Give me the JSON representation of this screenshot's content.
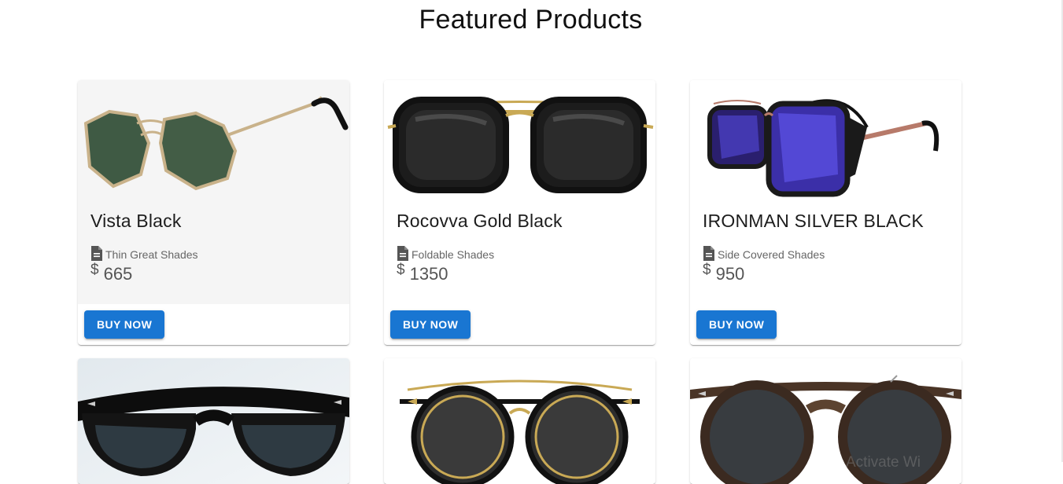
{
  "page": {
    "title": "Featured Products"
  },
  "products": [
    {
      "name": "Vista Black",
      "description": "Thin Great Shades",
      "currency_symbol": "$",
      "price": "665",
      "button_label": "BUY NOW",
      "image_icon": "aviator-hexagon-green-lens-sunglasses"
    },
    {
      "name": "Rocovva Gold Black",
      "description": "Foldable Shades",
      "currency_symbol": "$",
      "price": "1350",
      "button_label": "BUY NOW",
      "image_icon": "square-black-gold-bridge-sunglasses"
    },
    {
      "name": "IRONMAN SILVER BLACK",
      "description": "Side Covered Shades",
      "currency_symbol": "$",
      "price": "950",
      "button_label": "BUY NOW",
      "image_icon": "blue-mirror-side-shield-sunglasses"
    },
    {
      "image_icon": "black-wayfarer-sunglasses"
    },
    {
      "image_icon": "round-clip-on-gold-sunglasses"
    },
    {
      "image_icon": "round-tortoise-sunglasses"
    }
  ],
  "overlay": {
    "watermark_text": "Activate Wi"
  },
  "colors": {
    "button": "#1976d2",
    "card_tint": "#f5f5f5"
  }
}
